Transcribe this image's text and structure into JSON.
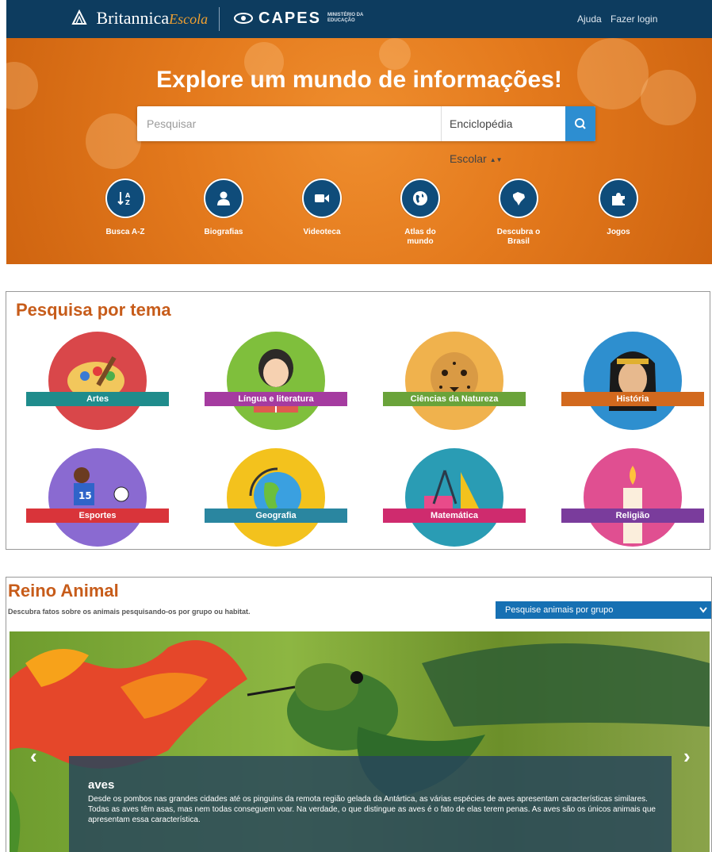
{
  "topbar": {
    "brand": "Britannica",
    "brand_script": "Escola",
    "partner": "CAPES",
    "ministry_line1": "MINISTÉRIO DA",
    "ministry_line2": "EDUCAÇÃO",
    "help": "Ajuda",
    "login": "Fazer login"
  },
  "hero": {
    "title": "Explore um mundo de informações!",
    "search_placeholder": "Pesquisar",
    "search_scope": "Enciclopédia Escolar",
    "shortcuts": [
      {
        "label": "Busca A-Z",
        "icon": "sort-az-icon"
      },
      {
        "label": "Biografias",
        "icon": "person-icon"
      },
      {
        "label": "Videoteca",
        "icon": "video-camera-icon"
      },
      {
        "label": "Atlas do mundo",
        "icon": "globe-icon"
      },
      {
        "label": "Descubra o Brasil",
        "icon": "brazil-map-icon"
      },
      {
        "label": "Jogos",
        "icon": "puzzle-icon"
      }
    ]
  },
  "topics": {
    "title": "Pesquisa por tema",
    "items": [
      {
        "label": "Artes",
        "ribbon": "#1f8c8c",
        "disc": "#d9474a"
      },
      {
        "label": "Língua e literatura",
        "ribbon": "#a53ba0",
        "disc": "#7fbf3c"
      },
      {
        "label": "Ciências da Natureza",
        "ribbon": "#6aa33a",
        "disc": "#f0b24d"
      },
      {
        "label": "História",
        "ribbon": "#d2691e",
        "disc": "#2e8fcf"
      },
      {
        "label": "Esportes",
        "ribbon": "#d9343a",
        "disc": "#8a6ad1"
      },
      {
        "label": "Geografia",
        "ribbon": "#2a86a0",
        "disc": "#f3c21d"
      },
      {
        "label": "Matemática",
        "ribbon": "#cf2b6e",
        "disc": "#2a9cb4"
      },
      {
        "label": "Religião",
        "ribbon": "#7a3c9c",
        "disc": "#e04f91"
      }
    ]
  },
  "animals": {
    "title": "Reino Animal",
    "subtitle": "Descubra fatos sobre os animais pesquisando-os por grupo ou habitat.",
    "group_select": "Pesquise animais por grupo",
    "slide_title": "aves",
    "slide_text": "Desde os pombos nas grandes cidades até os pinguins da remota região gelada da Antártica, as várias espécies de aves apresentam características similares. Todas as aves têm asas, mas nem todas conseguem voar. Na verdade, o que distingue as aves é o fato de elas terem penas. As aves são os únicos animais que apresentam essa característica."
  }
}
